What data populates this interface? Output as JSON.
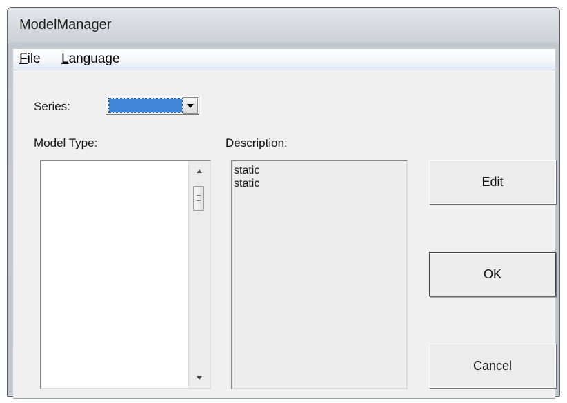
{
  "window": {
    "title": "ModelManager"
  },
  "menubar": {
    "file": {
      "accel": "F",
      "rest": "ile"
    },
    "language": {
      "accel": "L",
      "rest": "anguage"
    }
  },
  "series": {
    "label": "Series:",
    "selected_value": ""
  },
  "model_type": {
    "label": "Model Type:",
    "items": []
  },
  "description": {
    "label": "Description:",
    "lines": [
      "static",
      "static"
    ]
  },
  "buttons": {
    "edit": "Edit",
    "ok": "OK",
    "cancel": "Cancel"
  },
  "colors": {
    "selection": "#3f86d6",
    "client_bg": "#f0f0f0",
    "menubar_accent": "#dfe8f3"
  }
}
